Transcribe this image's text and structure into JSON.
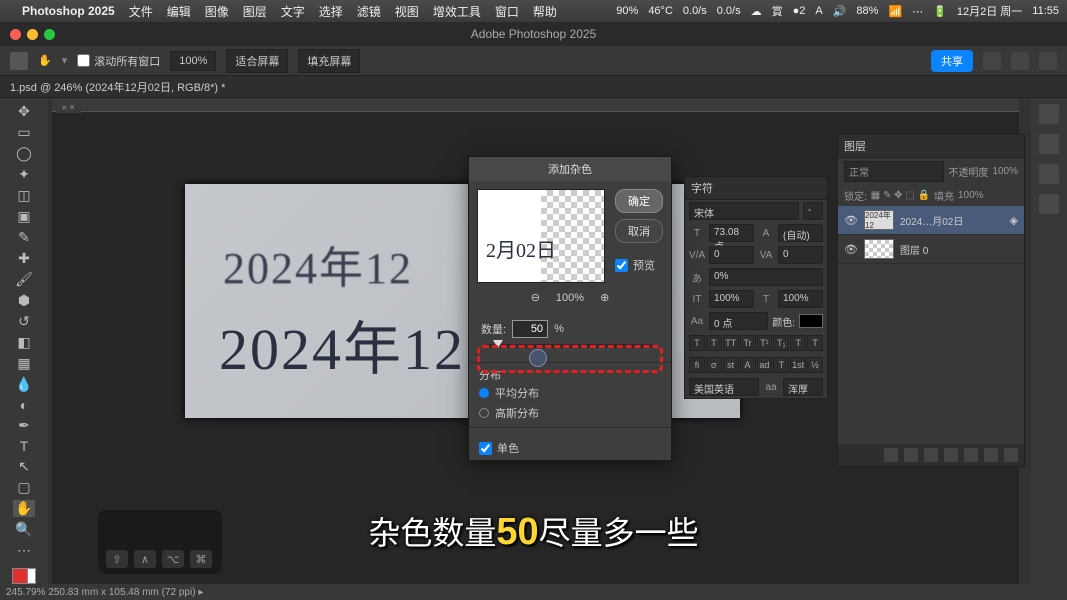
{
  "menubar": {
    "app": "Photoshop 2025",
    "items": [
      "文件",
      "编辑",
      "图像",
      "图层",
      "文字",
      "选择",
      "滤镜",
      "视图",
      "增效工具",
      "窗口",
      "帮助"
    ],
    "right": [
      "90%",
      "46°C",
      "0.0/s",
      "0.0/s",
      "☁",
      "賞",
      "●2",
      "A",
      "🔊",
      "88%",
      "📶",
      "⋯",
      "🔋",
      "12月2日 周一",
      "11:55"
    ]
  },
  "titlebar": {
    "title": "Adobe Photoshop 2025"
  },
  "optionbar": {
    "scroll": "滚动所有窗口",
    "zoom": "100%",
    "fit": "适合屏幕",
    "fill": "填充屏幕",
    "share": "共享"
  },
  "tab": {
    "label": "1.psd @ 246% (2024年12月02日, RGB/8*) *"
  },
  "canvas": {
    "text1": "2024年12",
    "text2": "2024年12"
  },
  "dialog": {
    "title": "添加杂色",
    "ok": "确定",
    "cancel": "取消",
    "preview_check": "预览",
    "preview_text": "2月02日",
    "zoom_pct": "100%",
    "amount_label": "数量:",
    "amount_value": "50",
    "amount_unit": "%",
    "dist_label": "分布",
    "dist_uniform": "平均分布",
    "dist_gaussian": "高斯分布",
    "mono": "单色"
  },
  "char_panel": {
    "title": "字符",
    "font": "宋体",
    "size": "73.08 点",
    "leading": "(自动)",
    "va1": "0",
    "va2": "0",
    "scale": "0%",
    "h": "100%",
    "v": "100%",
    "baseline": "0 点",
    "colorlabel": "颜色:",
    "lang": "美国英语",
    "aa": "浑厚"
  },
  "layers": {
    "title": "图层",
    "mode": "正常",
    "opacity_label": "不透明度",
    "opacity": "100%",
    "lock": "锁定:",
    "fill_label": "填充",
    "fill": "100%",
    "items": [
      {
        "name": "2024…月02日",
        "thumb": "2024年12"
      },
      {
        "name": "图层 0",
        "thumb": ""
      }
    ]
  },
  "subtitle": {
    "pre": "杂色数量",
    "num": "50",
    "post": "尽量多一些"
  },
  "status": "245.79%  250.83 mm x 105.48 mm (72 ppi)  ▸",
  "touchbar_keys": [
    "⇧",
    "∧",
    "⌥",
    "⌘"
  ]
}
